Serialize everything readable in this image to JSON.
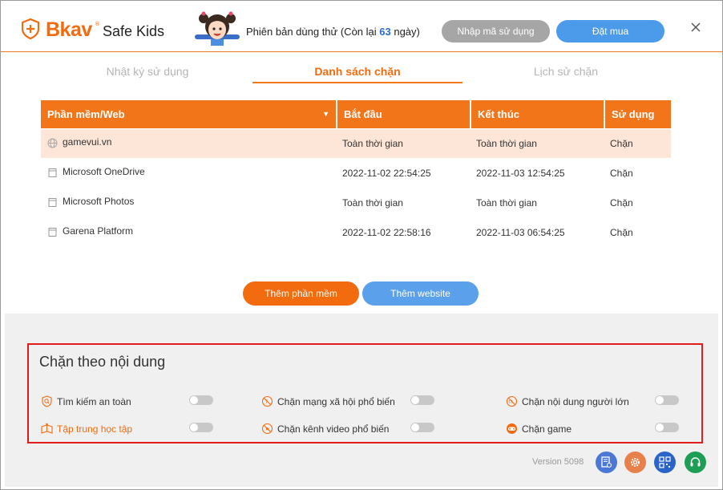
{
  "header": {
    "brand": "Bkav",
    "tm": "®",
    "product": "Safe Kids",
    "trial_prefix": "Phiên bản dùng thử (Còn lại ",
    "trial_days": "63",
    "trial_suffix": " ngày)",
    "code_button": "Nhập mã sử dụng",
    "buy_button": "Đặt mua"
  },
  "tabs": [
    {
      "label": "Nhật ký sử dụng",
      "active": false
    },
    {
      "label": "Danh sách chặn",
      "active": true
    },
    {
      "label": "Lịch sử chặn",
      "active": false
    }
  ],
  "table": {
    "headers": [
      "Phần mềm/Web",
      "Bắt đầu",
      "Kết thúc",
      "Sử dụng"
    ],
    "rows": [
      {
        "icon": "globe-icon",
        "name": "gamevui.vn",
        "start": "Toàn thời gian",
        "end": "Toàn thời gian",
        "use": "Chặn",
        "selected": true
      },
      {
        "icon": "app-icon",
        "name": "Microsoft OneDrive",
        "start": "2022-11-02 22:54:25",
        "end": "2022-11-03 12:54:25",
        "use": "Chặn",
        "selected": false
      },
      {
        "icon": "app-icon",
        "name": "Microsoft Photos",
        "start": "Toàn thời gian",
        "end": "Toàn thời gian",
        "use": "Chặn",
        "selected": false
      },
      {
        "icon": "app-icon",
        "name": "Garena Platform",
        "start": "2022-11-02 22:58:16",
        "end": "2022-11-03 06:54:25",
        "use": "Chặn",
        "selected": false
      }
    ]
  },
  "actions": {
    "add_app": "Thêm phần mềm",
    "add_web": "Thêm website"
  },
  "content_block": {
    "title": "Chặn theo nội dung",
    "options": [
      {
        "label": "Tìm kiếm an toàn",
        "icon": "safe-search-icon",
        "enabled": false
      },
      {
        "label": "Chặn mạng xã hội phổ biến",
        "icon": "social-network-icon",
        "enabled": false
      },
      {
        "label": "Chặn nội dung người lớn",
        "icon": "adult-content-icon",
        "enabled": false
      },
      {
        "label": "Tập trung học tập",
        "icon": "study-focus-icon",
        "enabled": false
      },
      {
        "label": "Chặn kênh video phổ biến",
        "icon": "video-channel-icon",
        "enabled": false
      },
      {
        "label": "Chặn game",
        "icon": "gamepad-icon",
        "enabled": false
      }
    ]
  },
  "footer": {
    "version": "Version 5098",
    "icons": [
      "feedback-icon",
      "settings-icon",
      "qr-code-icon",
      "support-headset-icon"
    ]
  },
  "colors": {
    "brand_orange": "#f26b0f",
    "blue": "#4c9bea",
    "highlight_red": "#e01c1c"
  }
}
